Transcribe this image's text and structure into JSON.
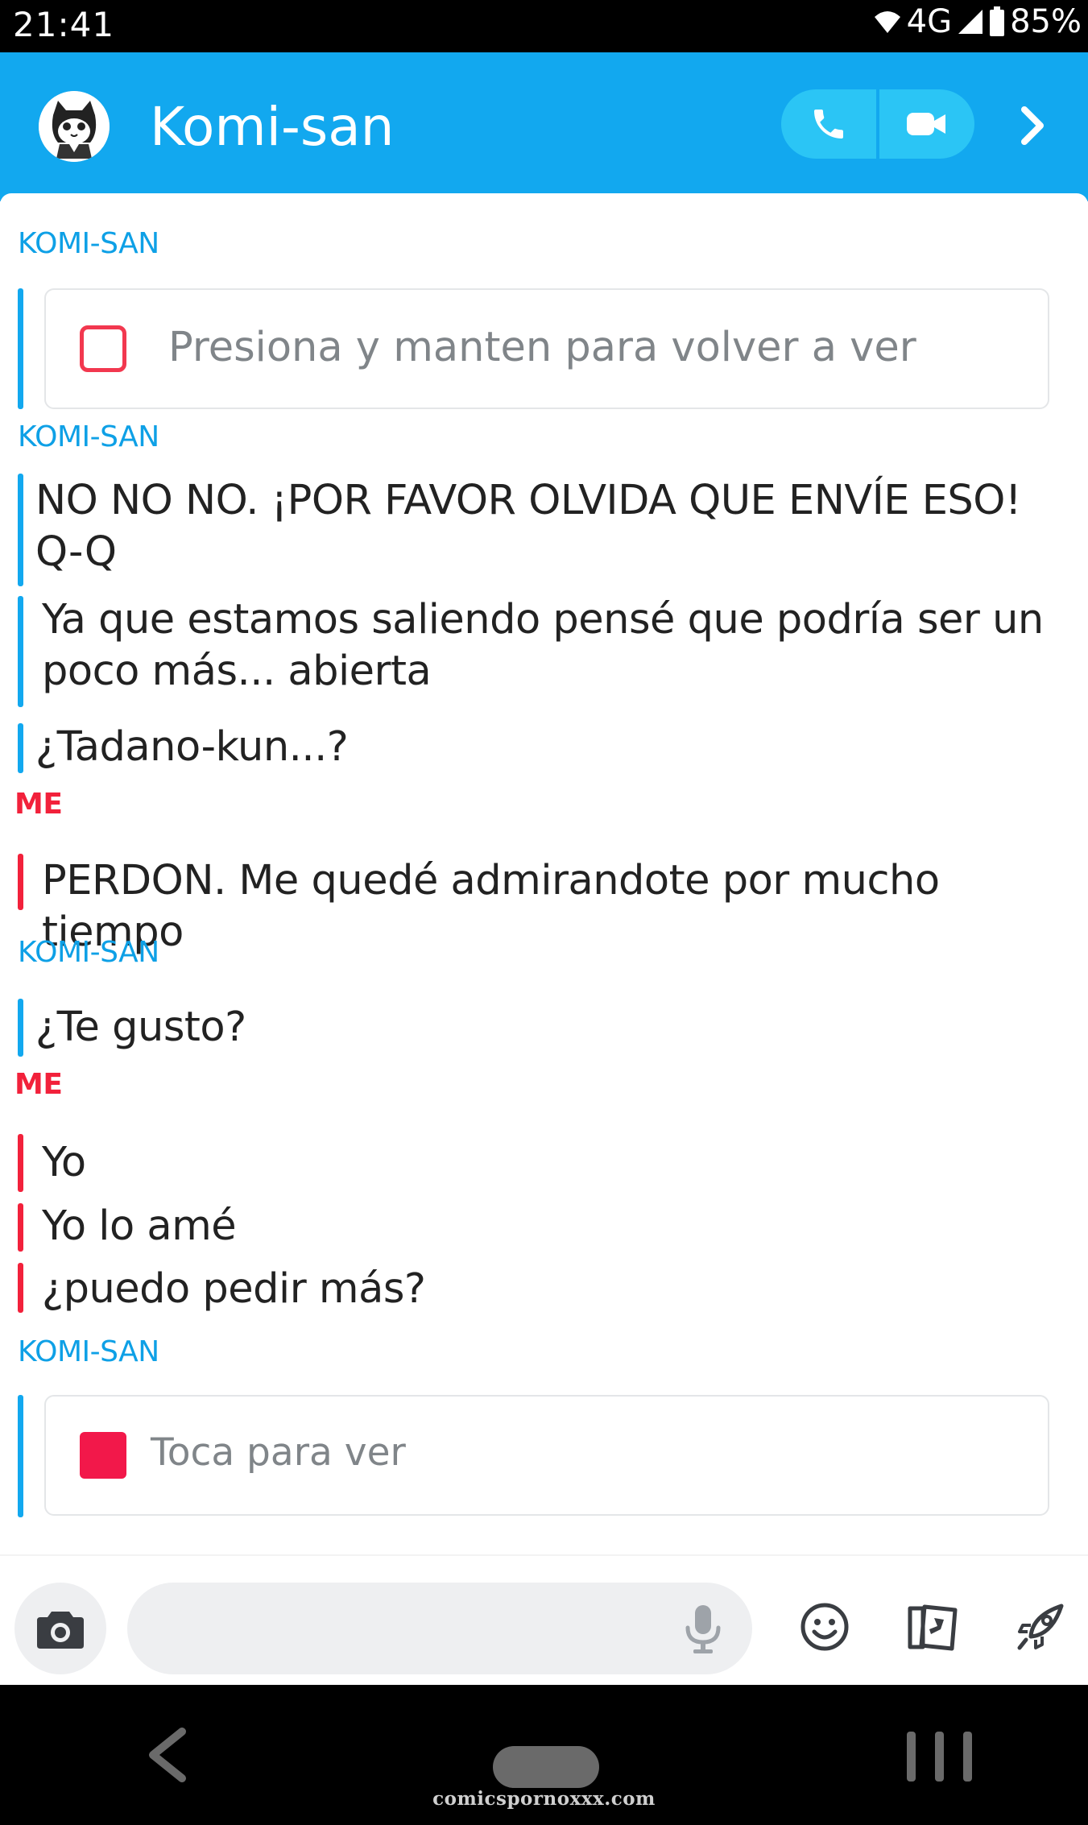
{
  "status_bar": {
    "time": "21:41",
    "network": "4G",
    "battery": "85%"
  },
  "header": {
    "title": "Komi-san",
    "avatar_icon": "cat-avatar-icon",
    "accent": "#12a8ef"
  },
  "chat": {
    "komi_label": "KOMI-SAN",
    "me_label": "ME",
    "komi_color": "#12a8ef",
    "me_color": "#f2213b",
    "card1_text": "Presiona y manten para volver a ver",
    "msg1_line1": "NO NO NO. ¡POR FAVOR OLVIDA QUE ENVÍE ESO!",
    "msg1_line2": "Q-Q",
    "msg2_line1": "Ya que estamos saliendo pensé que podría ser un",
    "msg2_line2": "poco más... abierta",
    "msg3": "¿Tadano-kun...?",
    "msg4": "PERDON. Me quedé admirandote por mucho tiempo",
    "msg5": "¿Te gusto?",
    "msg6": "Yo",
    "msg7": "Yo lo amé",
    "msg8": "¿puedo pedir más?",
    "card2_text": "Toca para ver"
  },
  "compose": {
    "camera_icon": "camera-icon",
    "mic_icon": "mic-icon",
    "emoji_icon": "smiley-icon",
    "stickers_icon": "cards-icon",
    "rocket_icon": "rocket-icon"
  },
  "nav": {
    "watermark": "comicspornoxxx.com"
  }
}
